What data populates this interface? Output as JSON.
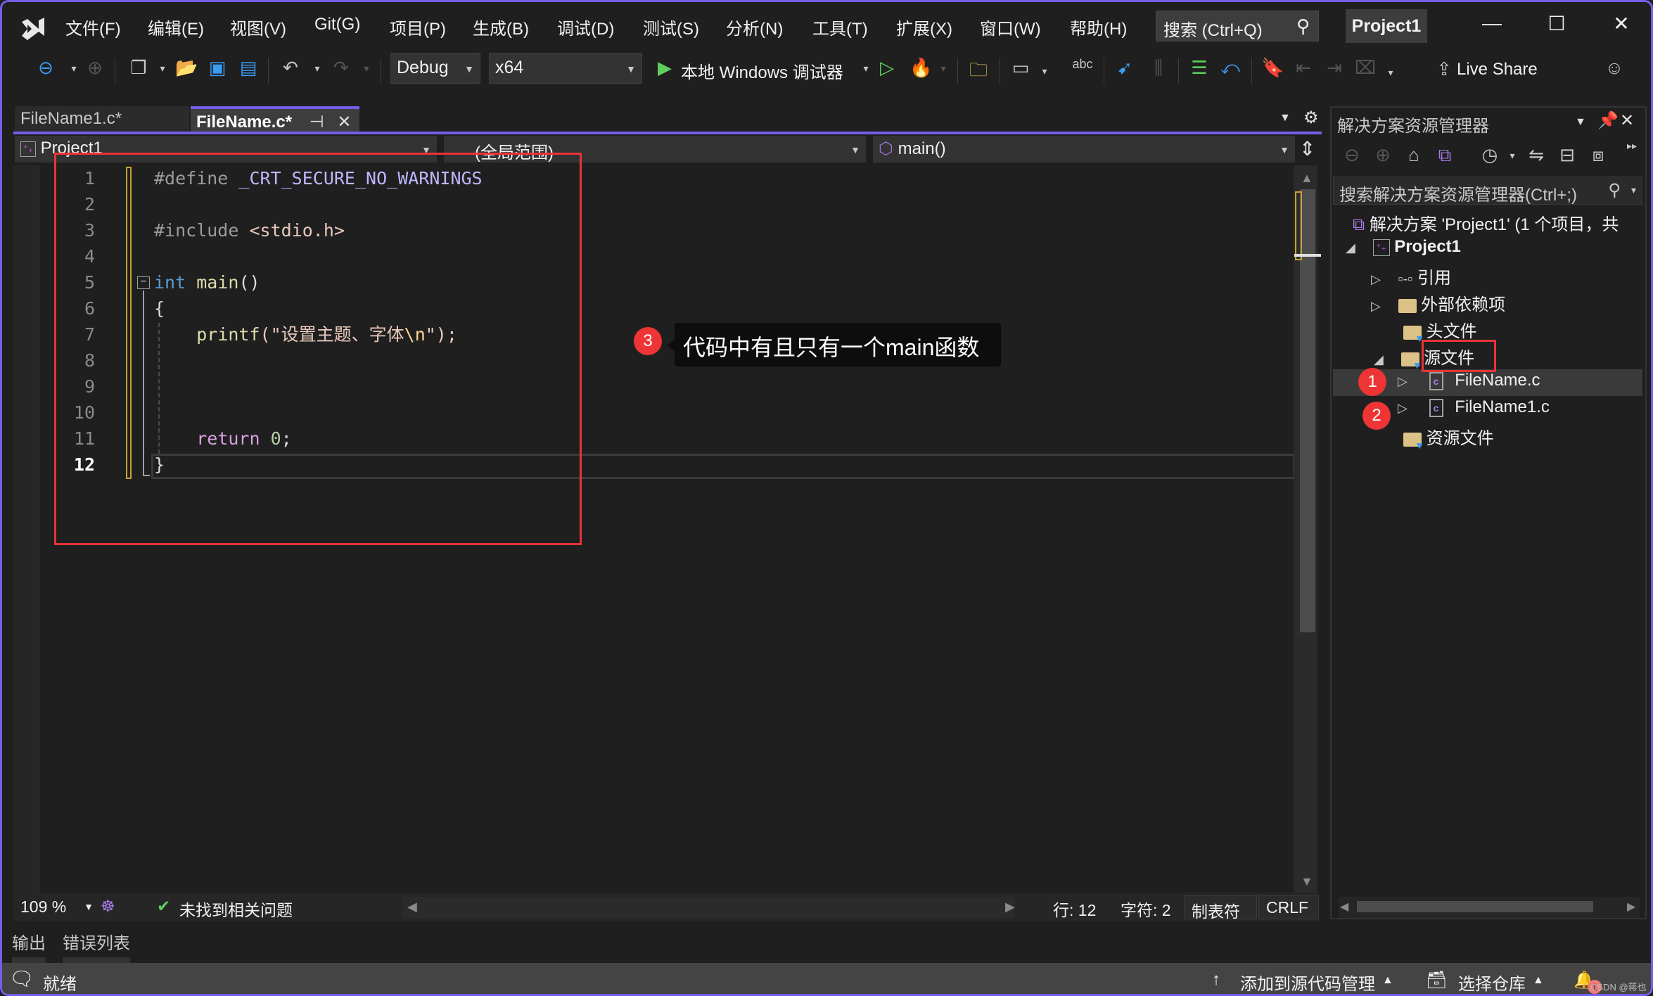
{
  "menubar": {
    "items": [
      "文件(F)",
      "编辑(E)",
      "视图(V)",
      "Git(G)",
      "项目(P)",
      "生成(B)",
      "调试(D)",
      "测试(S)",
      "分析(N)",
      "工具(T)",
      "扩展(X)",
      "窗口(W)",
      "帮助(H)"
    ],
    "search_placeholder": "搜索 (Ctrl+Q)",
    "project_title": "Project1",
    "window_controls": {
      "minimize": "—",
      "maximize": "☐",
      "close": "✕"
    }
  },
  "toolbar": {
    "configuration": "Debug",
    "platform": "x64",
    "run_label": "本地 Windows 调试器",
    "live_share": "Live Share"
  },
  "tabs": [
    {
      "label": "FileName1.c*",
      "active": false
    },
    {
      "label": "FileName.c*",
      "active": true,
      "pin": "⊣",
      "close": "✕"
    }
  ],
  "navbar": {
    "project": "Project1",
    "scope": "(全局范围)",
    "member": "main()"
  },
  "code": {
    "lines": [
      {
        "n": "1",
        "text": "#define _CRT_SECURE_NO_WARNINGS"
      },
      {
        "n": "2",
        "text": ""
      },
      {
        "n": "3",
        "text": "#include <stdio.h>"
      },
      {
        "n": "4",
        "text": ""
      },
      {
        "n": "5",
        "text": "int main()"
      },
      {
        "n": "6",
        "text": "{"
      },
      {
        "n": "7",
        "text": "    printf(\"设置主题、字体\\n\");"
      },
      {
        "n": "8",
        "text": ""
      },
      {
        "n": "9",
        "text": ""
      },
      {
        "n": "10",
        "text": ""
      },
      {
        "n": "11",
        "text": "    return 0;"
      },
      {
        "n": "12",
        "text": "}"
      }
    ],
    "tokens": {
      "define": "#define",
      "macro": "_CRT_SECURE_NO_WARNINGS",
      "include": "#include",
      "header": "<stdio.h>",
      "int": "int",
      "main": "main",
      "parens": "()",
      "open_brace": "{",
      "printf": "printf",
      "str_open": "(\"设置主题、字体",
      "esc": "\\n",
      "str_close": "\");",
      "return": "return",
      "zero": "0",
      "semi": ";",
      "close_brace": "}"
    },
    "current_line": 12
  },
  "annotations": {
    "callout_badge": "3",
    "callout_text": "代码中有且只有一个main函数",
    "badge1": "1",
    "badge2": "2"
  },
  "editor_status": {
    "zoom": "109 %",
    "issues": "未找到相关问题",
    "line": "行: 12",
    "char": "字符: 2",
    "indent": "制表符",
    "eol": "CRLF"
  },
  "bottom_tabs": [
    "输出",
    "错误列表"
  ],
  "statusbar": {
    "ready": "就绪",
    "add_source_control": "添加到源代码管理",
    "select_repo": "选择仓库",
    "notifications": "1",
    "watermark": "CSDN @蒋也"
  },
  "solution_explorer": {
    "title": "解决方案资源管理器",
    "search_placeholder": "搜索解决方案资源管理器(Ctrl+;)",
    "tree": [
      {
        "label": "解决方案 'Project1' (1 个项目，共",
        "level": 0,
        "icon": "solution-icon"
      },
      {
        "label": "Project1",
        "level": 1,
        "icon": "project-icon",
        "expanded": true
      },
      {
        "label": "引用",
        "level": 2,
        "icon": "references-icon",
        "expanded": false
      },
      {
        "label": "外部依赖项",
        "level": 2,
        "icon": "external-deps-icon",
        "expanded": false
      },
      {
        "label": "头文件",
        "level": 2,
        "icon": "filter-folder-icon"
      },
      {
        "label": "源文件",
        "level": 2,
        "icon": "filter-folder-icon",
        "expanded": true,
        "highlighted": true
      },
      {
        "label": "FileName.c",
        "level": 3,
        "icon": "c-file-icon",
        "selected": true
      },
      {
        "label": "FileName1.c",
        "level": 3,
        "icon": "c-file-icon"
      },
      {
        "label": "资源文件",
        "level": 2,
        "icon": "filter-folder-icon"
      }
    ]
  },
  "colors": {
    "accent": "#7160e8",
    "annotation_red": "#e8333a",
    "background": "#1f1f1f"
  }
}
